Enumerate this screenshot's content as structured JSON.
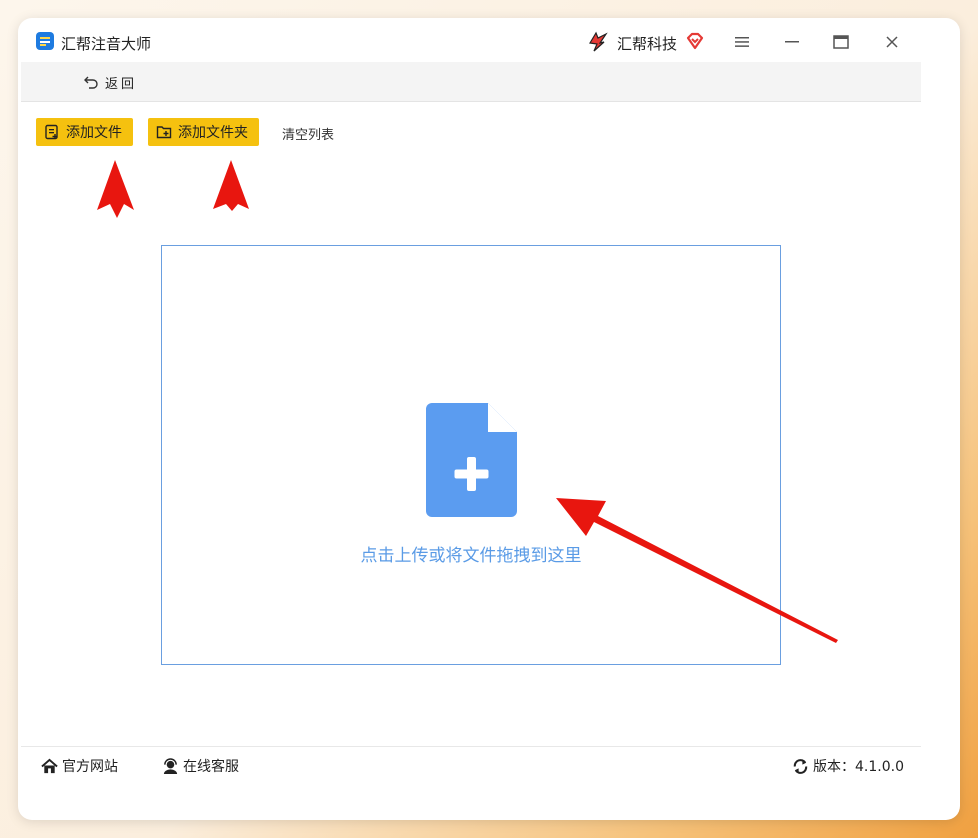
{
  "app": {
    "title": "汇帮注音大师",
    "brand": "汇帮科技",
    "brand_color": "#e53935",
    "icons": {
      "app": "app-logo-icon",
      "brand": "brand-logo-icon",
      "vip": "vip-diamond-icon",
      "menu": "menu-icon",
      "minimize": "minimize-icon",
      "maximize": "maximize-icon",
      "close": "close-icon"
    }
  },
  "nav": {
    "back_label": "返回",
    "back_icon": "undo-arrow-icon"
  },
  "toolbar": {
    "add_file_label": "添加文件",
    "add_folder_label": "添加文件夹",
    "clear_label": "清空列表",
    "accent": "#f5c10f"
  },
  "dropzone": {
    "text": "点击上传或将文件拖拽到这里",
    "icon": "file-add-icon",
    "border_color": "#6a9fe0",
    "icon_color": "#5b9cf0"
  },
  "footer": {
    "site_label": "官方网站",
    "service_label": "在线客服",
    "version_label": "版本：4.1.0.0"
  },
  "annotations": {
    "arrow_color": "#e8160f"
  }
}
